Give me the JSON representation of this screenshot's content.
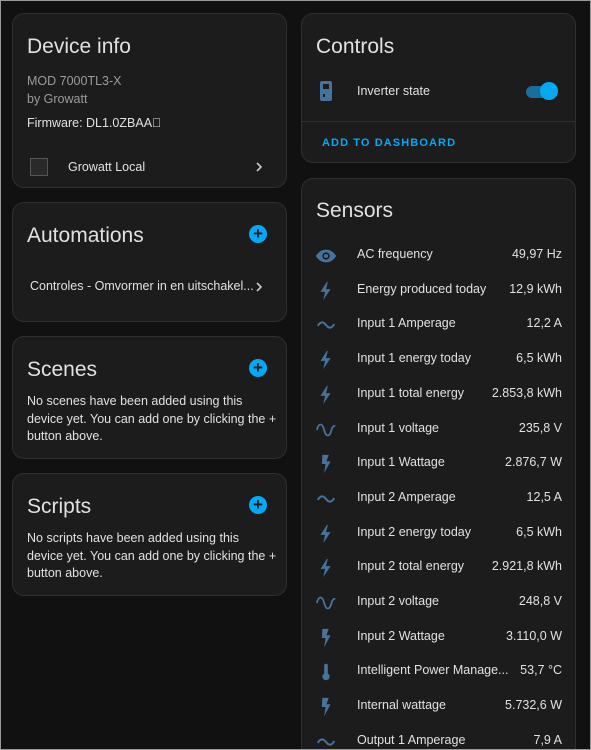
{
  "device_info": {
    "title": "Device info",
    "model": "MOD 7000TL3-X",
    "manufacturer": "by Growatt",
    "firmware": "Firmware: DL1.0ZBAA\u0000",
    "integration": "Growatt Local"
  },
  "automations": {
    "title": "Automations",
    "items": [
      {
        "label": "Controles - Omvormer in en uitschakel..."
      }
    ]
  },
  "scenes": {
    "title": "Scenes",
    "empty_text": "No scenes have been added using this device yet. You can add one by clicking the + button above."
  },
  "scripts": {
    "title": "Scripts",
    "empty_text": "No scripts have been added using this device yet. You can add one by clicking the + button above."
  },
  "controls": {
    "title": "Controls",
    "items": [
      {
        "label": "Inverter state",
        "state": "on",
        "icon": "inverter-icon"
      }
    ],
    "add_to_dashboard": "ADD TO DASHBOARD"
  },
  "sensors": {
    "title": "Sensors",
    "items": [
      {
        "icon": "eye-icon",
        "name": "AC frequency",
        "value": "49,97 Hz"
      },
      {
        "icon": "lightning-icon",
        "name": "Energy produced today",
        "value": "12,9 kWh"
      },
      {
        "icon": "current-ac-icon",
        "name": "Input 1 Amperage",
        "value": "12,2 A"
      },
      {
        "icon": "lightning-icon",
        "name": "Input 1 energy today",
        "value": "6,5 kWh"
      },
      {
        "icon": "lightning-icon",
        "name": "Input 1 total energy",
        "value": "2.853,8 kWh"
      },
      {
        "icon": "sine-wave-icon",
        "name": "Input 1 voltage",
        "value": "235,8 V"
      },
      {
        "icon": "flash-icon",
        "name": "Input 1 Wattage",
        "value": "2.876,7 W"
      },
      {
        "icon": "current-ac-icon",
        "name": "Input 2 Amperage",
        "value": "12,5 A"
      },
      {
        "icon": "lightning-icon",
        "name": "Input 2 energy today",
        "value": "6,5 kWh"
      },
      {
        "icon": "lightning-icon",
        "name": "Input 2 total energy",
        "value": "2.921,8 kWh"
      },
      {
        "icon": "sine-wave-icon",
        "name": "Input 2 voltage",
        "value": "248,8 V"
      },
      {
        "icon": "flash-icon",
        "name": "Input 2 Wattage",
        "value": "3.110,0 W"
      },
      {
        "icon": "thermometer-icon",
        "name": "Intelligent Power Manage...",
        "value": "53,7 °C"
      },
      {
        "icon": "flash-icon",
        "name": "Internal wattage",
        "value": "5.732,6 W"
      },
      {
        "icon": "current-ac-icon",
        "name": "Output 1 Amperage",
        "value": "7,9 A"
      }
    ]
  },
  "colors": {
    "accent": "#03a9f4",
    "icon": "#44739e",
    "card_bg": "#1c1c1c",
    "page_bg": "#111111"
  }
}
